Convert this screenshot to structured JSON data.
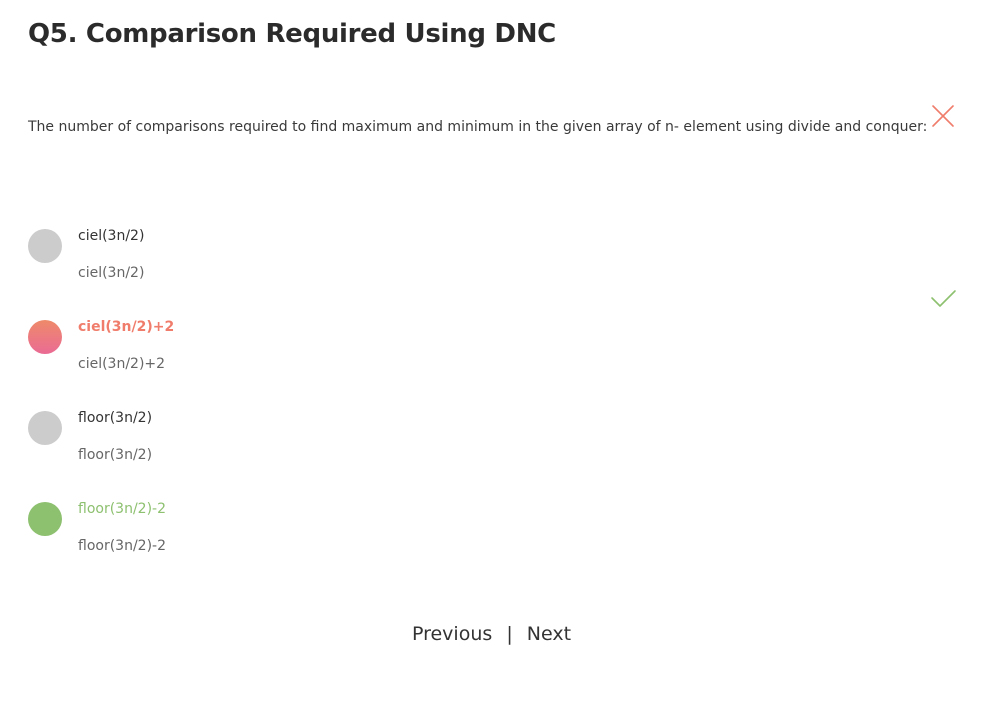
{
  "question": {
    "title": "Q5. Comparison Required Using DNC",
    "text": "The number of comparisons required to find maximum and minimum in the given array of n- element using divide and conquer:"
  },
  "options": [
    {
      "label": "ciel(3n/2)",
      "sub": "ciel(3n/2)",
      "state": "neutral"
    },
    {
      "label": "ciel(3n/2)+2",
      "sub": "ciel(3n/2)+2",
      "state": "selected-wrong"
    },
    {
      "label": "floor(3n/2)",
      "sub": "floor(3n/2)",
      "state": "neutral"
    },
    {
      "label": "floor(3n/2)-2",
      "sub": "floor(3n/2)-2",
      "state": "correct"
    }
  ],
  "colors": {
    "neutral_radio": "#cccccc",
    "wrong": "#f07d6c",
    "wrong_gradient_end": "#ea6b94",
    "correct": "#8dc06f"
  },
  "icons": {
    "wrong_mark": "close-icon",
    "correct_mark": "check-icon"
  },
  "nav": {
    "previous": "Previous",
    "separator": "|",
    "next": "Next"
  }
}
